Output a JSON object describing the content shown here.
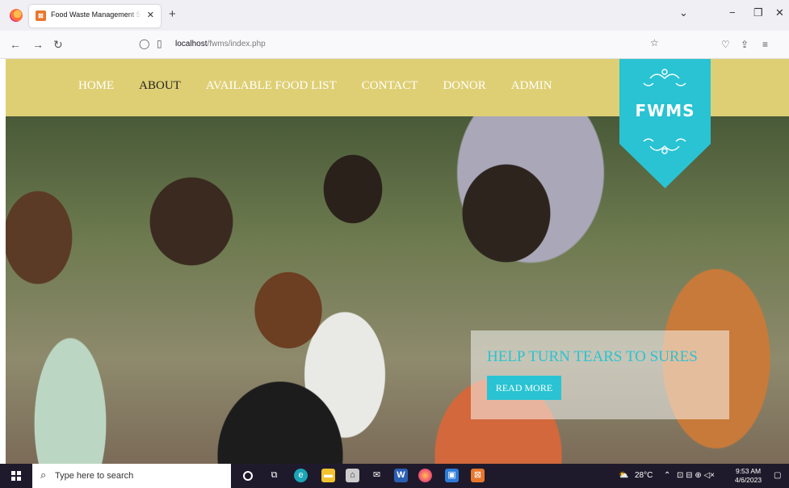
{
  "browser": {
    "tab_title": "Food Waste Management System",
    "tab_icon": "xampp-icon",
    "url_host": "localhost",
    "url_path": "/fwms/index.php"
  },
  "site": {
    "menu": [
      "HOME",
      "ABOUT",
      "AVAILABLE FOOD LIST",
      "CONTACT",
      "DONOR",
      "ADMIN"
    ],
    "active_menu": "ABOUT",
    "logo": "FWMS",
    "hero_title": "HELP TURN TEARS TO SURES",
    "hero_button": "READ MORE",
    "colors": {
      "header": "#dfcf74",
      "accent": "#29c3d3"
    }
  },
  "taskbar": {
    "search_placeholder": "Type here to search",
    "weather": "28°C",
    "time": "9:53 AM",
    "date": "4/6/2023"
  }
}
